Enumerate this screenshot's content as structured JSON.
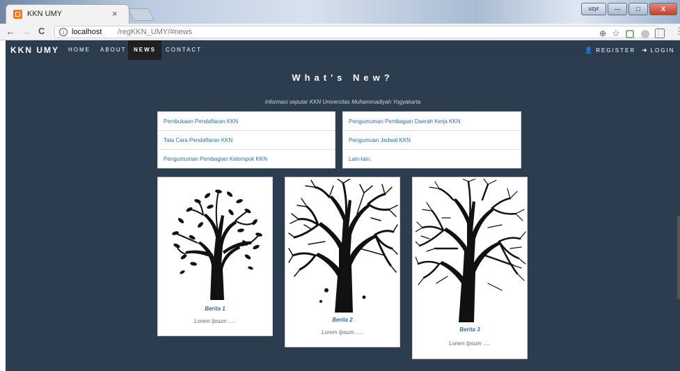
{
  "browser": {
    "tab_title": "KKN UMY",
    "tab_close": "×",
    "url_host": "localhost",
    "url_path": "/regKKN_UMY/#news",
    "window_user": "uzyr",
    "window_minimize": "—",
    "window_maximize": "□",
    "window_close": "X",
    "back_glyph": "←",
    "forward_glyph": "→",
    "reload_glyph": "C",
    "info_glyph": "i",
    "zoom_glyph": "⊕",
    "star_glyph": "☆",
    "menu_glyph": "⋮"
  },
  "navbar": {
    "brand": "KKN UMY",
    "links": [
      {
        "label": "HOME"
      },
      {
        "label": "ABOUT"
      },
      {
        "label": "NEWS"
      },
      {
        "label": "CONTACT"
      }
    ],
    "register_icon": "👤",
    "register": "REGISTER",
    "login_icon": "➜",
    "login": "LOGIN"
  },
  "news": {
    "title": "What's New?",
    "subtitle": "Informasi seputar KKN Universitas Muhammadiyah Yogyakarta",
    "left_links": [
      "Pembukaan Pendaftaran KKN",
      "Tata Cara Pendaftaran KKN",
      "Pengumuman Pembagian Kelompok KKN"
    ],
    "right_links": [
      "Pengumuman Pembagian Daerah Kerja KKN",
      "Pengumuan Jadwal KKN",
      "Lain-lain."
    ],
    "cards": [
      {
        "title": "Berita 1",
        "text": "Lorem Ipsum ....."
      },
      {
        "title": "Berita 2",
        "text": "Lorem Ipsum ....."
      },
      {
        "title": "Berita 3",
        "text": "Lorem Ipsum ....."
      }
    ]
  },
  "icons": {
    "favicon": "kkn-favicon-icon",
    "info": "info-icon",
    "search": "zoom-icon",
    "bookmark": "star-icon",
    "register": "user-icon",
    "login": "login-icon"
  },
  "colors": {
    "page_background": "#2d3d50",
    "navbar_background": "#2c3c4f",
    "active_nav": "#1f1f1f",
    "link_blue": "#2f6dad"
  }
}
